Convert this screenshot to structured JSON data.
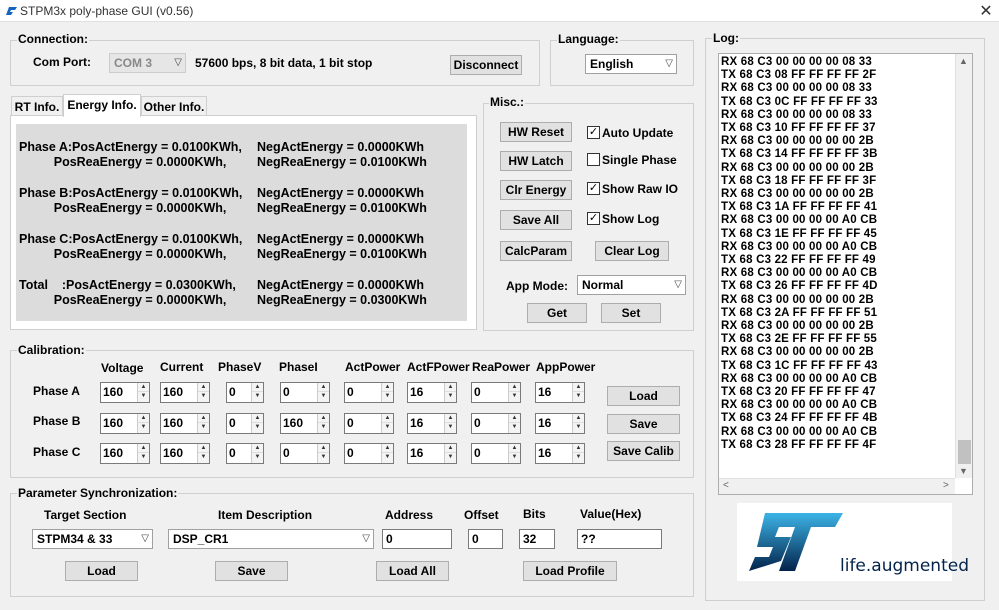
{
  "window": {
    "title": "STPM3x poly-phase GUI (v0.56)",
    "close": "✕"
  },
  "connection": {
    "group_label": "Connection:",
    "com_port_label": "Com Port:",
    "com_port_value": "COM 3",
    "settings": "57600 bps, 8 bit data, 1 bit stop",
    "disconnect": "Disconnect"
  },
  "language": {
    "group_label": "Language:",
    "value": "English"
  },
  "tabs": [
    {
      "label": "RT Info."
    },
    {
      "label": "Energy Info."
    },
    {
      "label": "Other Info."
    }
  ],
  "energy": {
    "phaseA_1": "Phase A:PosActEnergy = 0.0100KWh,",
    "phaseA_2": "          PosReaEnergy = 0.0000KWh,",
    "phaseA_3": "NegActEnergy = 0.0000KWh",
    "phaseA_4": "NegReaEnergy = 0.0100KWh",
    "phaseB_1": "Phase B:PosActEnergy = 0.0100KWh,",
    "phaseB_2": "          PosReaEnergy = 0.0000KWh,",
    "phaseB_3": "NegActEnergy = 0.0000KWh",
    "phaseB_4": "NegReaEnergy = 0.0100KWh",
    "phaseC_1": "Phase C:PosActEnergy = 0.0100KWh,",
    "phaseC_2": "          PosReaEnergy = 0.0000KWh,",
    "phaseC_3": "NegActEnergy = 0.0000KWh",
    "phaseC_4": "NegReaEnergy = 0.0100KWh",
    "total_1": "Total    :PosActEnergy = 0.0300KWh,",
    "total_2": "          PosReaEnergy = 0.0000KWh,",
    "total_3": "NegActEnergy = 0.0000KWh",
    "total_4": "NegReaEnergy = 0.0300KWh"
  },
  "misc": {
    "group_label": "Misc.:",
    "hw_reset": "HW Reset",
    "hw_latch": "HW Latch",
    "clr_energy": "Clr Energy",
    "save_all": "Save All",
    "calc_param": "CalcParam",
    "clear_log": "Clear Log",
    "auto_update": "Auto Update",
    "single_phase": "Single Phase",
    "show_raw_io": "Show Raw IO",
    "show_log": "Show Log",
    "check_mark": "✓",
    "app_mode_label": "App Mode:",
    "app_mode_value": "Normal",
    "get": "Get",
    "set": "Set"
  },
  "calibration": {
    "group_label": "Calibration:",
    "headers": [
      "Voltage",
      "Current",
      "PhaseV",
      "PhaseI",
      "ActPower",
      "ActFPower",
      "ReaPower",
      "AppPower"
    ],
    "rows": [
      {
        "label": "Phase A",
        "values": [
          "160",
          "160",
          "0",
          "0",
          "0",
          "16",
          "0",
          "16"
        ]
      },
      {
        "label": "Phase B",
        "values": [
          "160",
          "160",
          "0",
          "160",
          "0",
          "16",
          "0",
          "16"
        ]
      },
      {
        "label": "Phase C",
        "values": [
          "160",
          "160",
          "0",
          "0",
          "0",
          "16",
          "0",
          "16"
        ]
      }
    ],
    "load": "Load",
    "save": "Save",
    "save_calib": "Save Calib"
  },
  "param_sync": {
    "group_label": "Parameter Synchronization:",
    "target_section_label": "Target Section",
    "target_section_value": "STPM34 & 33",
    "item_desc_label": "Item Description",
    "item_desc_value": "DSP_CR1",
    "address_label": "Address",
    "address_value": "0",
    "offset_label": "Offset",
    "offset_value": "0",
    "bits_label": "Bits",
    "bits_value": "32",
    "value_label": "Value(Hex)",
    "value_value": "??",
    "load": "Load",
    "save": "Save",
    "load_all": "Load All",
    "load_profile": "Load Profile"
  },
  "log": {
    "group_label": "Log:",
    "lines": [
      "RX 68 C3 00 00 00 00 08 33",
      "TX 68 C3 08 FF FF FF FF 2F",
      "RX 68 C3 00 00 00 00 08 33",
      "TX 68 C3 0C FF FF FF FF 33",
      "RX 68 C3 00 00 00 00 08 33",
      "TX 68 C3 10 FF FF FF FF 37",
      "RX 68 C3 00 00 00 00 00 2B",
      "TX 68 C3 14 FF FF FF FF 3B",
      "RX 68 C3 00 00 00 00 00 2B",
      "TX 68 C3 18 FF FF FF FF 3F",
      "RX 68 C3 00 00 00 00 00 2B",
      "TX 68 C3 1A FF FF FF FF 41",
      "RX 68 C3 00 00 00 00 A0 CB",
      "TX 68 C3 1E FF FF FF FF 45",
      "RX 68 C3 00 00 00 00 A0 CB",
      "TX 68 C3 22 FF FF FF FF 49",
      "RX 68 C3 00 00 00 00 A0 CB",
      "TX 68 C3 26 FF FF FF FF 4D",
      "RX 68 C3 00 00 00 00 00 2B",
      "TX 68 C3 2A FF FF FF FF 51",
      "RX 68 C3 00 00 00 00 00 2B",
      "TX 68 C3 2E FF FF FF FF 55",
      "RX 68 C3 00 00 00 00 00 2B",
      "TX 68 C3 1C FF FF FF FF 43",
      "RX 68 C3 00 00 00 00 A0 CB",
      "TX 68 C3 20 FF FF FF FF 47",
      "RX 68 C3 00 00 00 00 A0 CB",
      "TX 68 C3 24 FF FF FF FF 4B",
      "RX 68 C3 00 00 00 00 A0 CB",
      "TX 68 C3 28 FF FF FF FF 4F"
    ]
  },
  "brand": {
    "tagline": "life.augmented",
    "primary_color": "#03234b",
    "accent_color": "#3cb4e6"
  }
}
